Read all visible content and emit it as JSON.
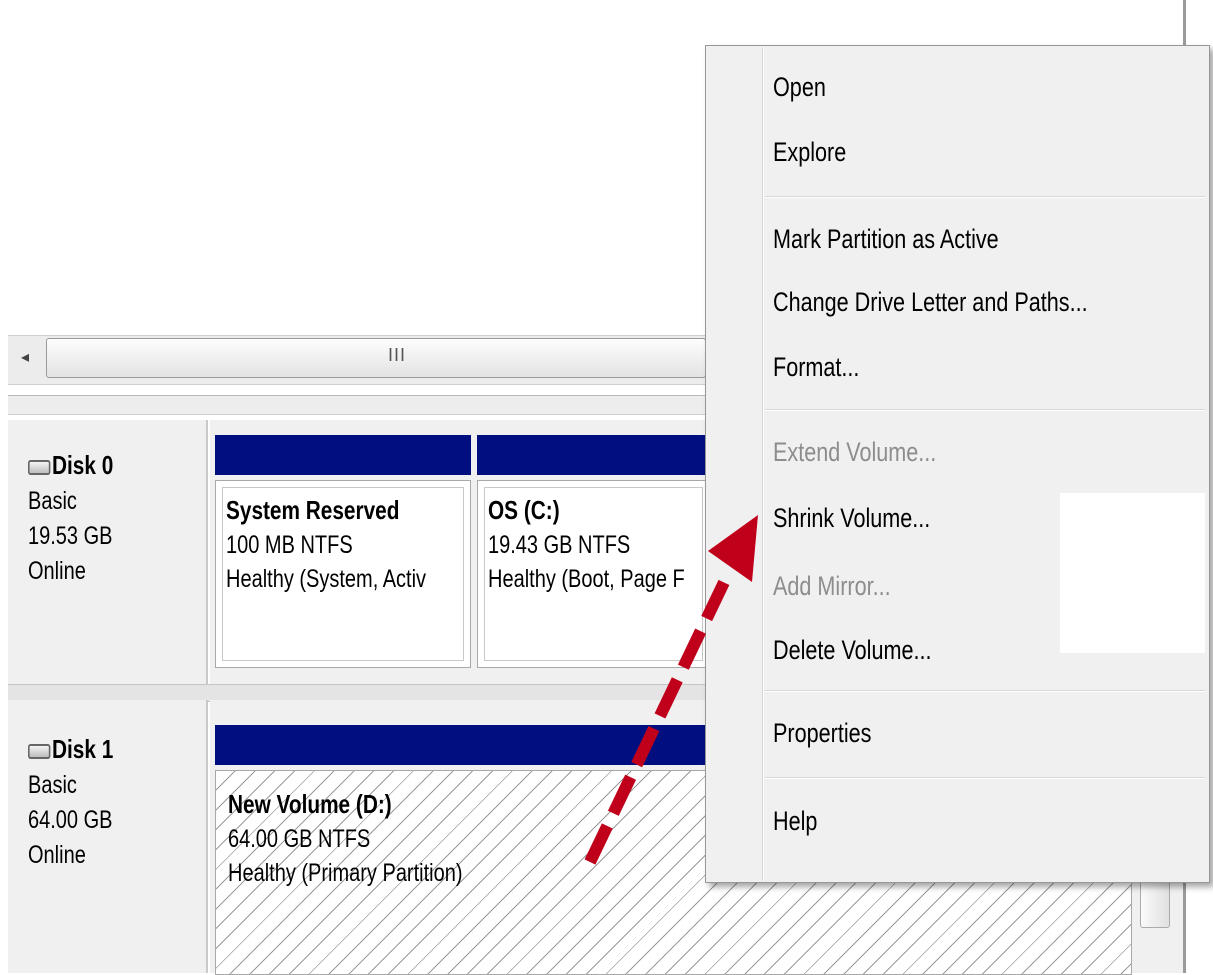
{
  "scrollbar": {
    "left_arrow": "◂",
    "grip": "III"
  },
  "disks": [
    {
      "name": "Disk 0",
      "type": "Basic",
      "size": "19.53 GB",
      "status": "Online"
    },
    {
      "name": "Disk 1",
      "type": "Basic",
      "size": "64.00 GB",
      "status": "Online"
    }
  ],
  "partitions": {
    "system_reserved": {
      "title": "System Reserved",
      "fs": "100 MB NTFS",
      "status": "Healthy (System, Activ"
    },
    "os_c": {
      "title": "OS  (C:)",
      "fs": "19.43 GB NTFS",
      "status": "Healthy (Boot, Page F"
    },
    "new_volume_d": {
      "title": "New Volume  (D:)",
      "fs": "64.00 GB NTFS",
      "status": "Healthy (Primary Partition)"
    }
  },
  "context_menu": {
    "items": [
      {
        "label": "Open",
        "enabled": true
      },
      {
        "label": "Explore",
        "enabled": true
      },
      {
        "label": "Mark Partition as Active",
        "enabled": true
      },
      {
        "label": "Change Drive Letter and Paths...",
        "enabled": true
      },
      {
        "label": "Format...",
        "enabled": true
      },
      {
        "label": "Extend Volume...",
        "enabled": false
      },
      {
        "label": "Shrink Volume...",
        "enabled": true
      },
      {
        "label": "Add Mirror...",
        "enabled": false
      },
      {
        "label": "Delete Volume...",
        "enabled": true
      },
      {
        "label": "Properties",
        "enabled": true
      },
      {
        "label": "Help",
        "enabled": true
      }
    ]
  },
  "colors": {
    "partition_header": "#000e80",
    "arrow": "#c0001a",
    "disabled_text": "#8d8d8d"
  }
}
